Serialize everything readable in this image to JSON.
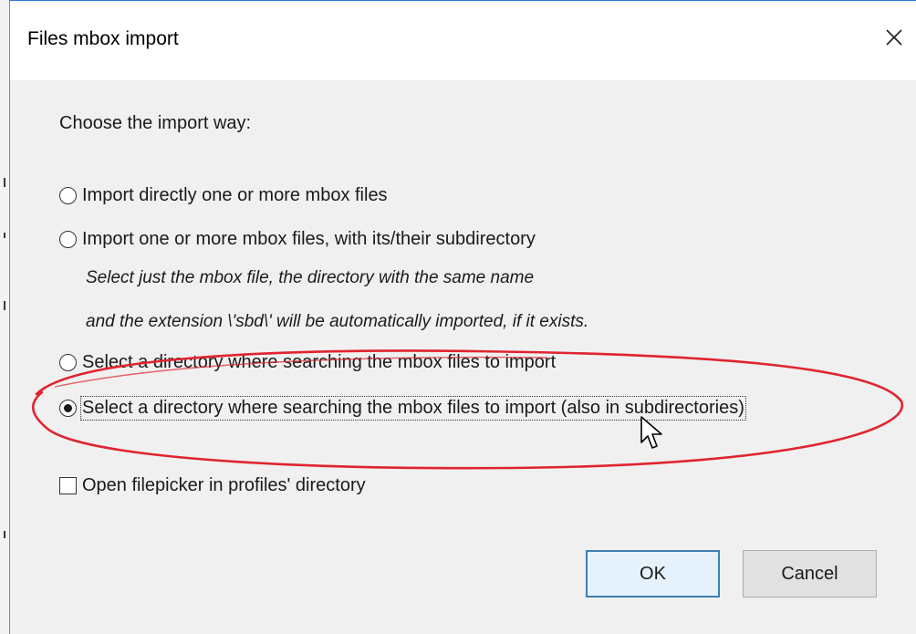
{
  "window": {
    "title": "Files mbox import",
    "close_symbol": "✕"
  },
  "dialog": {
    "prompt": "Choose the import way:",
    "options": [
      {
        "label": "Import directly one or more mbox files",
        "checked": false
      },
      {
        "label": "Import one or more mbox files, with its/their subdirectory",
        "checked": false
      },
      {
        "label": "Select a directory where searching the mbox files to import",
        "checked": false
      },
      {
        "label": "Select a directory where searching the mbox files to import (also in subdirectories)",
        "checked": true
      }
    ],
    "description_lines": [
      "Select just the mbox file, the directory with the same name",
      "and the extension \\'sbd\\' will be automatically imported, if it exists."
    ],
    "checkbox": {
      "label": "Open filepicker in profiles' directory",
      "checked": false
    },
    "buttons": {
      "ok": "OK",
      "cancel": "Cancel"
    }
  },
  "colors": {
    "dialog_background": "#f0f0f0",
    "title_background": "#ffffff",
    "ok_button_border": "#3c7fb1",
    "annotation_red": "#e0242f"
  },
  "icons": [
    "close-icon",
    "mouse-cursor-icon"
  ]
}
